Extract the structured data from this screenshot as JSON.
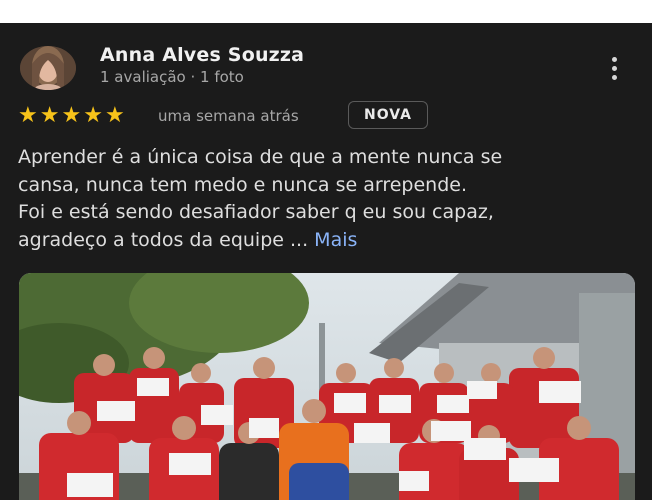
{
  "review": {
    "author_name": "Anna Alves Souzza",
    "author_meta": "1 avaliação · 1 foto",
    "rating": 5,
    "stars": [
      "★",
      "★",
      "★",
      "★",
      "★"
    ],
    "time_ago": "uma semana atrás",
    "badge": "NOVA",
    "text_lines": [
      "Aprender é a única coisa de que a mente nunca se",
      "cansa, nunca tem medo e nunca se arrepende.",
      "Foi e está sendo desafiador saber q eu sou capaz,",
      "agradeço a todos da equipe ..."
    ],
    "more_link": "Mais"
  },
  "icons": {
    "more_options": "more-vert-icon",
    "star": "star-icon"
  },
  "colors": {
    "card_background": "#1b1b1b",
    "star": "#f7c31a",
    "link": "#8ab4f8"
  }
}
